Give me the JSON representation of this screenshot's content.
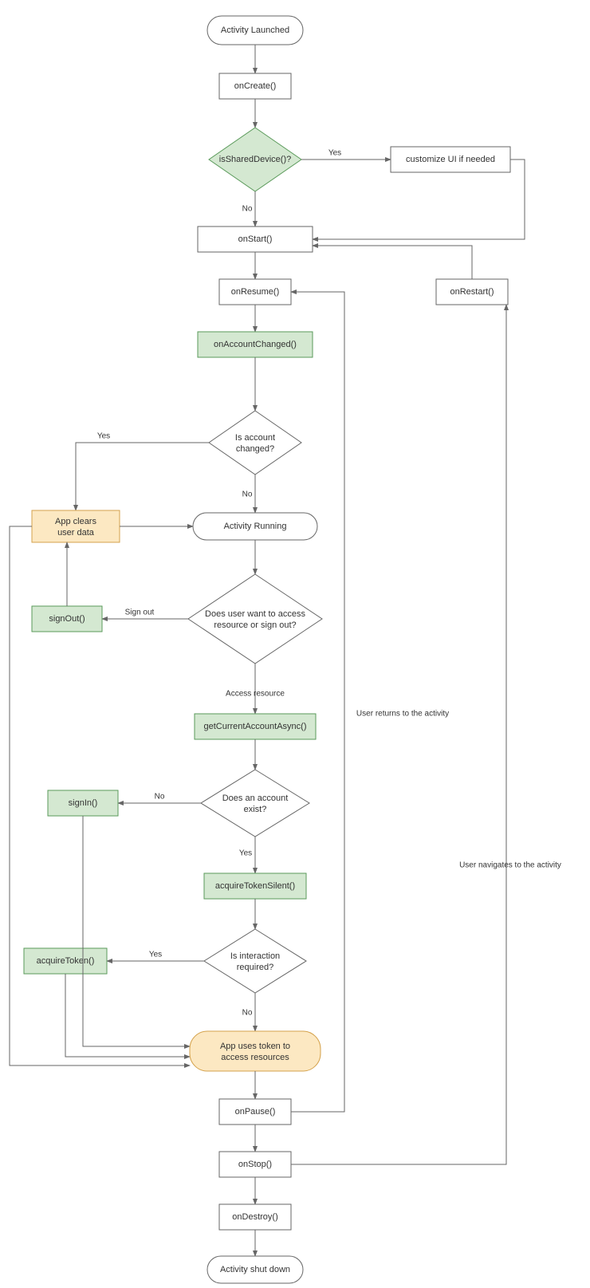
{
  "nodes": {
    "activity_launched": "Activity Launched",
    "on_create": "onCreate()",
    "is_shared_device": "isSharedDevice()?",
    "customize_ui": "customize UI if needed",
    "on_start": "onStart()",
    "on_resume": "onResume()",
    "on_restart": "onRestart()",
    "on_account_changed": "onAccountChanged()",
    "is_account_changed_l1": "Is account",
    "is_account_changed_l2": "changed?",
    "app_clears_l1": "App clears",
    "app_clears_l2": "user data",
    "activity_running": "Activity Running",
    "sign_out": "signOut()",
    "want_access_l1": "Does user want to access",
    "want_access_l2": "resource or sign out?",
    "get_current_account": "getCurrentAccountAsync()",
    "sign_in": "signIn()",
    "account_exist_l1": "Does an account",
    "account_exist_l2": "exist?",
    "acquire_token_silent": "acquireTokenSilent()",
    "acquire_token": "acquireToken()",
    "interaction_l1": "Is interaction",
    "interaction_l2": "required?",
    "app_uses_l1": "App uses token to",
    "app_uses_l2": "access resources",
    "on_pause": "onPause()",
    "on_stop": "onStop()",
    "on_destroy": "onDestroy()",
    "activity_shutdown": "Activity shut down"
  },
  "edges": {
    "yes": "Yes",
    "no": "No",
    "sign_out": "Sign out",
    "access_resource": "Access resource",
    "user_returns": "User returns to the activity",
    "user_navigates": "User navigates to the activity"
  }
}
